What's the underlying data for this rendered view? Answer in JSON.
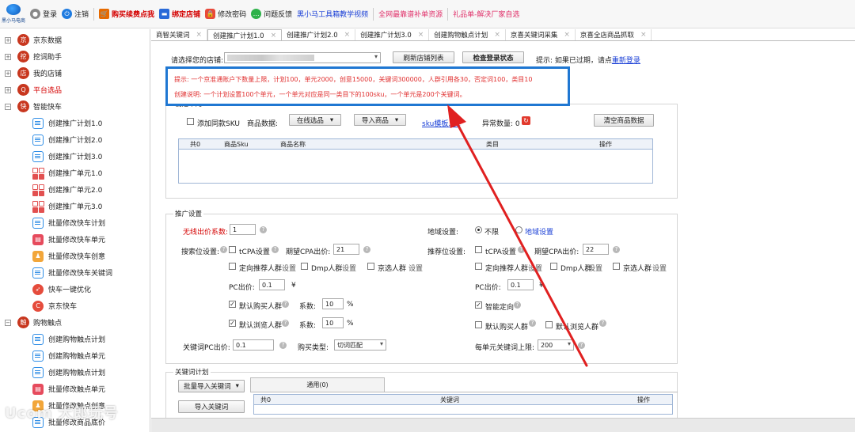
{
  "toolbar": {
    "logo_text": "黑小马电商",
    "items": [
      {
        "label": "登录",
        "icon": "user-icon"
      },
      {
        "label": "注销",
        "icon": "power-icon"
      },
      {
        "label": "购买续费点我",
        "icon": "cart-icon"
      },
      {
        "label": "绑定店铺",
        "icon": "car-icon"
      },
      {
        "label": "修改密码",
        "icon": "lock-icon"
      },
      {
        "label": "问题反馈",
        "icon": "chat-icon"
      },
      {
        "label": "黑小马工具箱教学视频"
      },
      {
        "label": "全网最靠谱补单资源"
      },
      {
        "label": "礼品单-解决厂家自选"
      }
    ]
  },
  "sidebar": {
    "groups": [
      {
        "label": "京东数据",
        "expander": "+"
      },
      {
        "label": "挖词助手",
        "expander": "+"
      },
      {
        "label": "我的店铺",
        "expander": "+"
      },
      {
        "label": "平台选品",
        "expander": "+"
      },
      {
        "label": "智能快车",
        "expander": "−"
      }
    ],
    "kuaiche_items": [
      "创建推广计划1.0",
      "创建推广计划2.0",
      "创建推广计划3.0",
      "创建推广单元1.0",
      "创建推广单元2.0",
      "创建推广单元3.0",
      "批量修改快车计划",
      "批量修改快车单元",
      "批量修改快车创意",
      "批量修改快车关键词",
      "快车一键优化",
      "京东快车"
    ],
    "touchpoint_group": {
      "label": "购物触点",
      "expander": "−"
    },
    "touchpoint_items": [
      "创建购物触点计划",
      "创建购物触点单元",
      "创建购物触点计划",
      "批量修改触点单元",
      "批量修改触点创意",
      "批量修改商品底价"
    ]
  },
  "tabs": [
    "商智关键词",
    "创建推广计划1.0",
    "创建推广计划2.0",
    "创建推广计划3.0",
    "创建购物触点计划",
    "京喜关键词采集",
    "京喜全店商品抓取"
  ],
  "tab_close": "×",
  "main": {
    "store_label": "请选择您的店铺:",
    "store_value": "",
    "refresh_button": "刷新店铺列表",
    "check_button": "检查登录状态",
    "hint_prefix": "提示: 如果已过期，请点",
    "relogin_link": "重新登录",
    "notice_line1": "提示: 一个京准通账户下数量上限，计划100，单元2000，创意15000，关键词300000，人群引用各30，否定词100，类目10",
    "notice_line2": "创建说明: 一个计划设置100个单元，一个单元对应是同一类目下的100sku，一个单元是200个关键词。",
    "unit_group_title": "创建单元",
    "add_same_sku": "添加同款SKU",
    "product_data_label": "商品数据:",
    "online_select": "在线选品",
    "import_product": "导入商品",
    "sku_template": "sku模板.txt",
    "abnormal_label": "异常数量: 0",
    "clear_button": "清空商品数据",
    "product_grid_headers": [
      "共0",
      "商品Sku",
      "商品名称",
      "类目",
      "操作"
    ],
    "promo_group_title": "推广设置",
    "wireless_label": "无线出价系数:",
    "wireless_value": "1",
    "region_label": "地域设置:",
    "region_unlimited": "不限",
    "region_setting": "地域设置",
    "search_slot_label": "搜索位设置:",
    "recommend_slot_label": "推荐位设置:",
    "tcpa_label": "tCPA设置",
    "cpa_label": "期望CPA出价:",
    "cpa_search_value": "21",
    "cpa_recommend_value": "22",
    "targeted_crowd": "定向推荐人群",
    "set_label": "设置",
    "dmp_crowd": "Dmp人群",
    "jx_crowd": "京选人群",
    "pc_bid_label": "PC出价:",
    "pc_bid_value": "0.1",
    "yen": "¥",
    "default_buy_crowd": "默认购买人群",
    "default_browse_crowd": "默认浏览人群",
    "coef_label": "系数:",
    "coef_value": "10",
    "percent": "%",
    "smart_targeting": "智能定向",
    "keyword_pc_label": "关键词PC出价:",
    "keyword_pc_value": "0.1",
    "match_type_label": "购买类型:",
    "match_type_value": "切词匹配",
    "unit_keyword_limit_label": "每单元关键词上限:",
    "unit_keyword_limit_value": "200",
    "keyword_group_title": "关键词计划",
    "bulk_import_keywords": "批量导入关键词",
    "import_keywords": "导入关键词",
    "keyword_tab": "通用(0)",
    "keyword_grid_headers": [
      "共0",
      "关键词",
      "操作"
    ]
  },
  "watermark": "Ucom 大郎玩号",
  "colors": {
    "accent_red": "#d40000",
    "link_blue": "#1a3fd6",
    "notice_border": "#1f77d2",
    "arrow": "#e02020"
  }
}
